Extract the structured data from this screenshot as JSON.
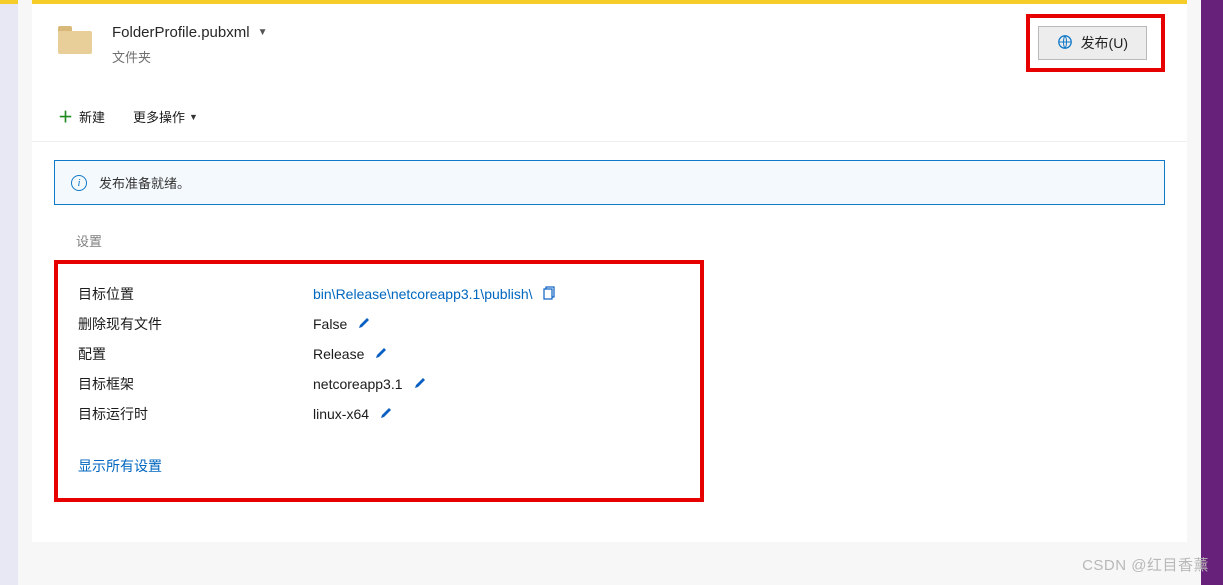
{
  "header": {
    "profile_name": "FolderProfile.pubxml",
    "subtitle": "文件夹",
    "publish_label": "发布(U)"
  },
  "toolbar": {
    "new_label": "新建",
    "more_label": "更多操作"
  },
  "info": {
    "message": "发布准备就绪。"
  },
  "settings_section_title": "设置",
  "settings": [
    {
      "label": "目标位置",
      "value": "bin\\Release\\netcoreapp3.1\\publish\\",
      "is_link": true,
      "editable": false,
      "copyable": true
    },
    {
      "label": "删除现有文件",
      "value": "False",
      "is_link": false,
      "editable": true,
      "copyable": false
    },
    {
      "label": "配置",
      "value": "Release",
      "is_link": false,
      "editable": true,
      "copyable": false
    },
    {
      "label": "目标框架",
      "value": "netcoreapp3.1",
      "is_link": false,
      "editable": true,
      "copyable": false
    },
    {
      "label": "目标运行时",
      "value": "linux-x64",
      "is_link": false,
      "editable": true,
      "copyable": false
    }
  ],
  "show_all_label": "显示所有设置",
  "watermark": "CSDN @红目香薰"
}
